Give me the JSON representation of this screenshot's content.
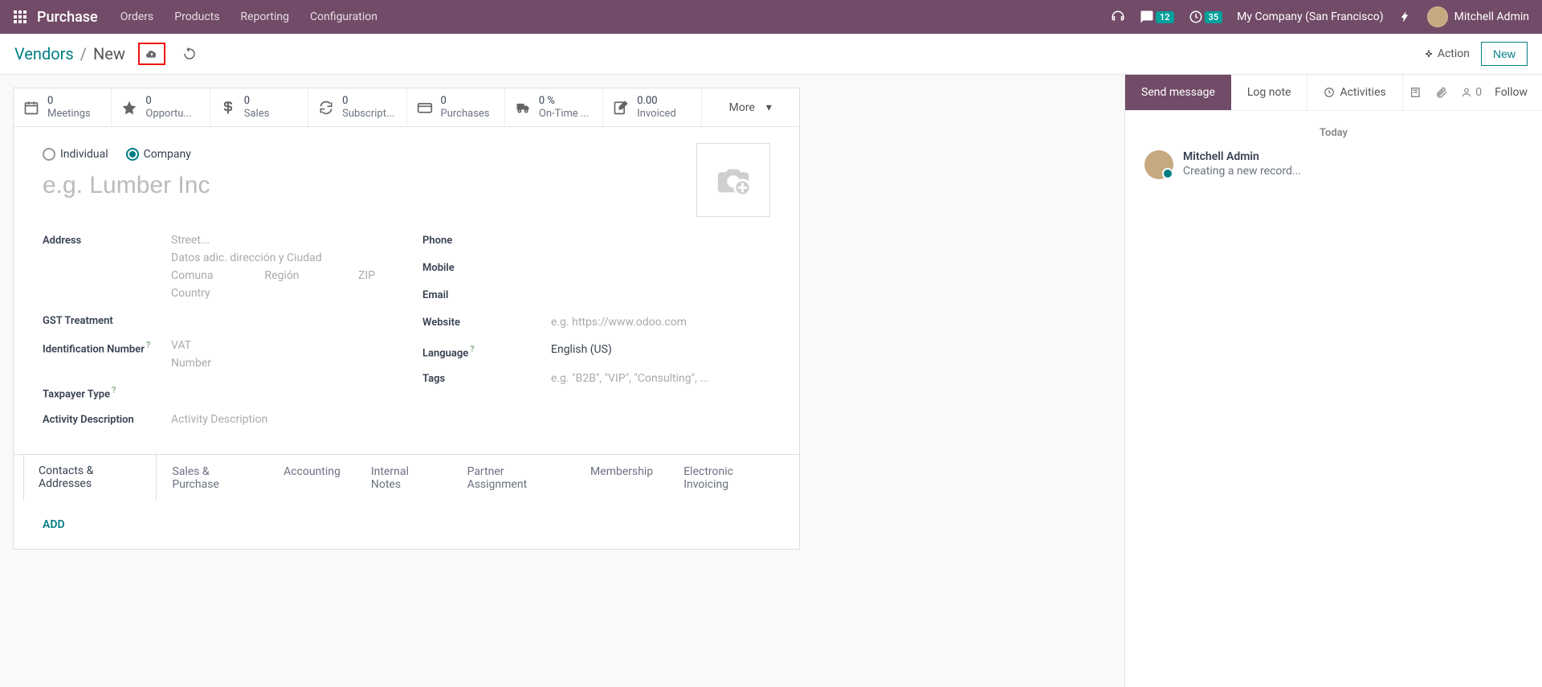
{
  "nav": {
    "brand": "Purchase",
    "menu": [
      "Orders",
      "Products",
      "Reporting",
      "Configuration"
    ],
    "messages_badge": "12",
    "activities_badge": "35",
    "company": "My Company (San Francisco)",
    "user": "Mitchell Admin"
  },
  "crumbs": {
    "parent": "Vendors",
    "current": "New",
    "action": "Action",
    "new": "New"
  },
  "stats": {
    "meetings": {
      "val": "0",
      "lbl": "Meetings"
    },
    "opportunities": {
      "val": "0",
      "lbl": "Opportu..."
    },
    "sales": {
      "val": "0",
      "lbl": "Sales"
    },
    "subscriptions": {
      "val": "0",
      "lbl": "Subscript..."
    },
    "purchases": {
      "val": "0",
      "lbl": "Purchases"
    },
    "ontime": {
      "val": "0 %",
      "lbl": "On-Time ..."
    },
    "invoiced": {
      "val": "0.00",
      "lbl": "Invoiced"
    },
    "more": "More"
  },
  "form": {
    "individual": "Individual",
    "company": "Company",
    "name_placeholder": "e.g. Lumber Inc",
    "labels": {
      "address": "Address",
      "gst": "GST Treatment",
      "idnum": "Identification Number",
      "taxpayer": "Taxpayer Type",
      "activity": "Activity Description",
      "phone": "Phone",
      "mobile": "Mobile",
      "email": "Email",
      "website": "Website",
      "language": "Language",
      "tags": "Tags"
    },
    "placeholders": {
      "street": "Street...",
      "street2": "Datos adic. dirección y Ciudad",
      "comuna": "Comuna",
      "region": "Región",
      "zip": "ZIP",
      "country": "Country",
      "vat": "VAT",
      "number": "Number",
      "activity": "Activity Description",
      "website": "e.g. https://www.odoo.com",
      "tags": "e.g. \"B2B\", \"VIP\", \"Consulting\", ..."
    },
    "language_value": "English (US)"
  },
  "tabs": [
    "Contacts & Addresses",
    "Sales & Purchase",
    "Accounting",
    "Internal Notes",
    "Partner Assignment",
    "Membership",
    "Electronic Invoicing"
  ],
  "add": "ADD",
  "chatter": {
    "send": "Send message",
    "log": "Log note",
    "activities": "Activities",
    "followers": "0",
    "follow": "Follow",
    "date": "Today",
    "msg_name": "Mitchell Admin",
    "msg_text": "Creating a new record..."
  }
}
